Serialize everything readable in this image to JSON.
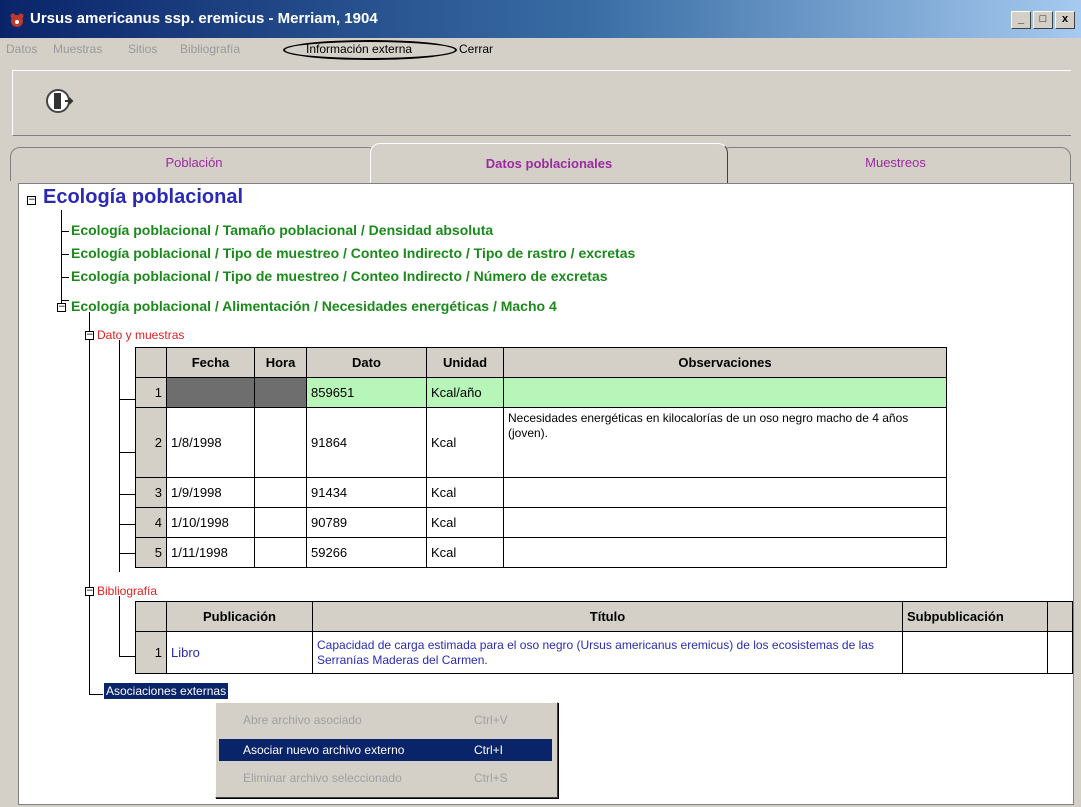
{
  "window": {
    "title": "Ursus americanus ssp. eremicus - Merriam, 1904",
    "minimize": "_",
    "maximize": "□",
    "close": "x"
  },
  "menu": [
    {
      "label": "Datos"
    },
    {
      "label": "Muestras"
    },
    {
      "label": "Sitios"
    },
    {
      "label": "Bibliografía"
    },
    {
      "label": "Información externa"
    },
    {
      "label": "Cerrar"
    }
  ],
  "tabs": [
    {
      "label": "Población"
    },
    {
      "label": "Datos poblacionales"
    },
    {
      "label": "Muestreos"
    }
  ],
  "tree": {
    "root": "Ecología poblacional",
    "paths": [
      "Ecología poblacional / Tamaño poblacional / Densidad absoluta",
      "Ecología poblacional / Tipo de muestreo / Conteo Indirecto / Tipo de rastro / excretas",
      "Ecología poblacional / Tipo de muestreo / Conteo Indirecto / Número de excretas",
      "Ecología poblacional / Alimentación / Necesidades energéticas / Macho 4"
    ],
    "section_data": "Dato y muestras",
    "section_biblio": "Bibliografía",
    "section_assoc": "Asociaciones externas"
  },
  "data_table": {
    "headers": [
      "Fecha",
      "Hora",
      "Dato",
      "Unidad",
      "Observaciones"
    ],
    "rows": [
      {
        "n": "1",
        "fecha": "",
        "hora": "",
        "dato": "859651",
        "unidad": "Kcal/año",
        "obs": ""
      },
      {
        "n": "2",
        "fecha": "1/8/1998",
        "hora": "",
        "dato": "91864",
        "unidad": "Kcal",
        "obs": "Necesidades energéticas en kilocalorías de un oso negro macho de 4 años (joven)."
      },
      {
        "n": "3",
        "fecha": "1/9/1998",
        "hora": "",
        "dato": "91434",
        "unidad": "Kcal",
        "obs": ""
      },
      {
        "n": "4",
        "fecha": "1/10/1998",
        "hora": "",
        "dato": "90789",
        "unidad": "Kcal",
        "obs": ""
      },
      {
        "n": "5",
        "fecha": "1/11/1998",
        "hora": "",
        "dato": "59266",
        "unidad": "Kcal",
        "obs": ""
      }
    ]
  },
  "biblio_table": {
    "headers": [
      "Publicación",
      "Título",
      "Subpublicación"
    ],
    "rows": [
      {
        "n": "1",
        "pub": "Libro",
        "titulo": "Capacidad de carga estimada para el oso negro (Ursus americanus eremicus) de los ecosistemas de las Serranías Maderas del Carmen.",
        "sub": ""
      }
    ]
  },
  "context_menu": [
    {
      "label": "Abre archivo asociado",
      "shortcut": "Ctrl+V"
    },
    {
      "label": "Asociar nuevo archivo externo",
      "shortcut": "Ctrl+I"
    },
    {
      "label": "Eliminar archivo seleccionado",
      "shortcut": "Ctrl+S"
    }
  ],
  "colors": {
    "title_blue": "#2a2ab5",
    "path_green": "#1a8a1a",
    "section_red": "#e02020",
    "tab_purple": "#9b2aa0",
    "selected_row": "#b8f5b8",
    "highlight": "#0a246a"
  }
}
